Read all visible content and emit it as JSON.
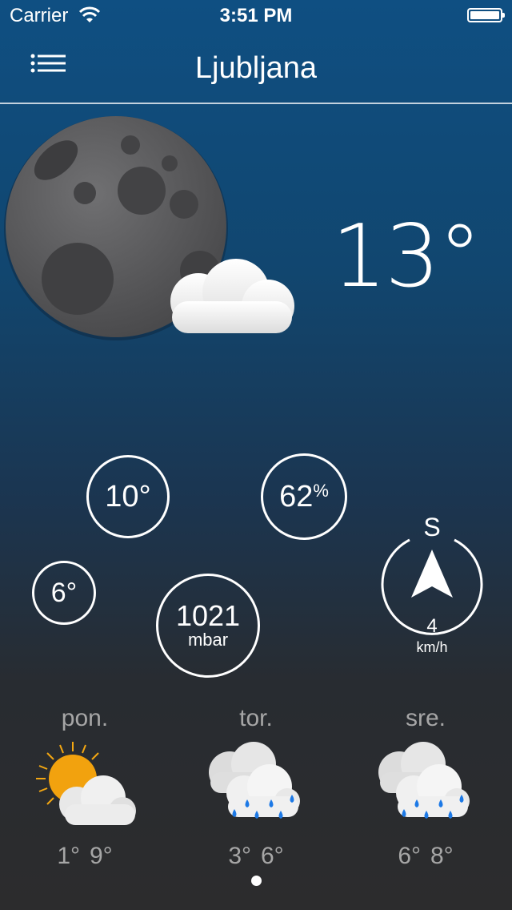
{
  "status_bar": {
    "carrier": "Carrier",
    "time": "3:51 PM"
  },
  "nav": {
    "city": "Ljubljana"
  },
  "current": {
    "temperature": "13°",
    "condition_icon": "moon-cloud-icon"
  },
  "stats": {
    "high": "10°",
    "low": "6°",
    "humidity_value": "62",
    "humidity_unit": "%",
    "pressure_value": "1021",
    "pressure_unit": "mbar",
    "wind_direction": "S",
    "wind_speed": "4",
    "wind_unit": "km/h"
  },
  "forecast": [
    {
      "day": "pon.",
      "low": "1°",
      "high": "9°",
      "icon": "sun-cloud-icon"
    },
    {
      "day": "tor.",
      "low": "3°",
      "high": "6°",
      "icon": "rain-cloud-icon"
    },
    {
      "day": "sre.",
      "low": "6°",
      "high": "8°",
      "icon": "rain-cloud-icon"
    }
  ],
  "colors": {
    "raindrop": "#1c79e6",
    "sun": "#f3a712"
  }
}
